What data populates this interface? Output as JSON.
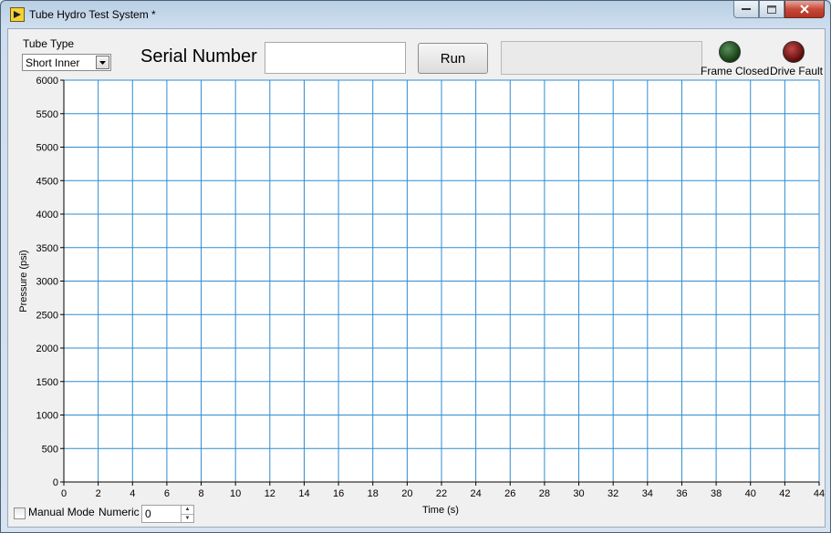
{
  "window": {
    "title": "Tube Hydro Test System *"
  },
  "controls": {
    "tube_type_label": "Tube Type",
    "tube_type_value": "Short Inner",
    "serial_label": "Serial Number",
    "serial_value": "",
    "run_label": "Run",
    "status_text": ""
  },
  "indicators": [
    {
      "label": "Frame Closed",
      "color": "#1e4d1e"
    },
    {
      "label": "Drive Fault",
      "color": "#8b1a1a"
    }
  ],
  "footer": {
    "manual_mode_label": "Manual Mode",
    "manual_mode_checked": false,
    "numeric_label": "Numeric",
    "numeric_value": "0"
  },
  "chart_data": {
    "type": "line",
    "xlabel": "Time (s)",
    "ylabel": "Pressure (psi)",
    "xlim": [
      0,
      44
    ],
    "ylim": [
      0,
      6000
    ],
    "x_ticks": [
      0,
      2,
      4,
      6,
      8,
      10,
      12,
      14,
      16,
      18,
      20,
      22,
      24,
      26,
      28,
      30,
      32,
      34,
      36,
      38,
      40,
      42,
      44
    ],
    "y_ticks": [
      0,
      500,
      1000,
      1500,
      2000,
      2500,
      3000,
      3500,
      4000,
      4500,
      5000,
      5500,
      6000
    ],
    "grid": true,
    "grid_color": "#2e8bd0",
    "series": []
  }
}
